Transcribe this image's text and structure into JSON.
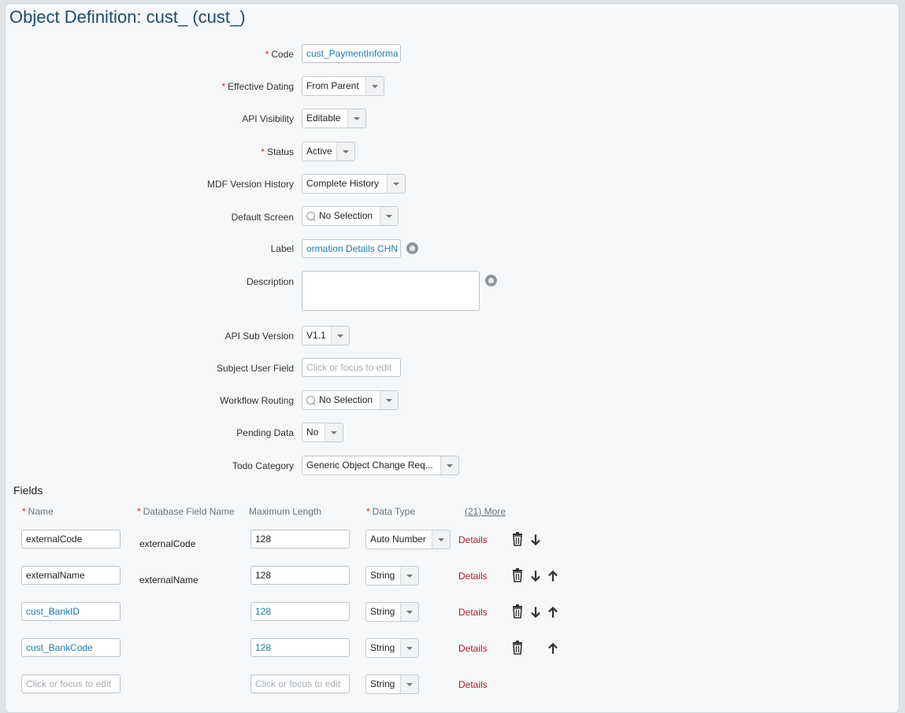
{
  "title": "Object Definition: cust_ (cust_)",
  "form": {
    "code": {
      "label": "Code",
      "value": "cust_PaymentInforma"
    },
    "effective_dating": {
      "label": "Effective Dating",
      "value": "From Parent"
    },
    "api_visibility": {
      "label": "API Visibility",
      "value": "Editable"
    },
    "status": {
      "label": "Status",
      "value": "Active"
    },
    "mdf_version_history": {
      "label": "MDF Version History",
      "value": "Complete History"
    },
    "default_screen": {
      "label": "Default Screen",
      "value": "No Selection"
    },
    "label_field": {
      "label": "Label",
      "value": "ormation Details CHN"
    },
    "description": {
      "label": "Description",
      "value": ""
    },
    "api_sub_version": {
      "label": "API Sub Version",
      "value": "V1.1"
    },
    "subject_user_field": {
      "label": "Subject User Field",
      "placeholder": "Click or focus to edit"
    },
    "workflow_routing": {
      "label": "Workflow Routing",
      "value": "No Selection"
    },
    "pending_data": {
      "label": "Pending Data",
      "value": "No"
    },
    "todo_category": {
      "label": "Todo Category",
      "value": "Generic Object Change Req..."
    }
  },
  "fields": {
    "section_title": "Fields",
    "headers": {
      "name": "Name",
      "db_field": "Database Field Name",
      "max_length": "Maximum Length",
      "data_type": "Data Type",
      "more": "(21) More"
    },
    "rows": [
      {
        "name": "externalCode",
        "db": "externalCode",
        "max": "128",
        "type": "Auto Number",
        "details": "Details"
      },
      {
        "name": "externalName",
        "db": "externalName",
        "max": "128",
        "type": "String",
        "details": "Details"
      },
      {
        "name": "cust_BankID",
        "db": "",
        "max": "128",
        "type": "String",
        "details": "Details"
      },
      {
        "name": "cust_BankCode",
        "db": "",
        "max": "128",
        "type": "String",
        "details": "Details"
      },
      {
        "name": "",
        "db": "",
        "max": "",
        "type": "String",
        "details": "Details"
      }
    ],
    "placeholder": "Click or focus to edit"
  },
  "icons": {
    "delete": "trash-icon",
    "down": "arrow-down-icon",
    "up": "arrow-up-icon",
    "globe": "globe-icon",
    "search": "search-icon"
  },
  "colors": {
    "title": "#1e4d6e",
    "link": "#1d7ba8",
    "required": "#e2231a",
    "details": "#a8202a"
  }
}
